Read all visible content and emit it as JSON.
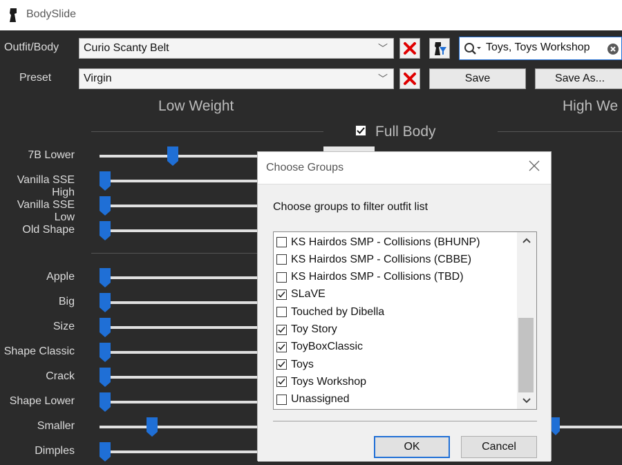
{
  "window": {
    "title": "BodySlide"
  },
  "outfit": {
    "label": "Outfit/Body",
    "value": "Curio Scanty Belt"
  },
  "preset": {
    "label": "Preset",
    "value": "Virgin",
    "save_label": "Save",
    "save_as_label": "Save As..."
  },
  "filter": {
    "value": "Toys, Toys Workshop"
  },
  "sections": {
    "low_weight": "Low Weight",
    "high_weight": "High We",
    "full_body": "Full Body"
  },
  "sliders": [
    {
      "label": "7B Lower",
      "value": 0.23
    },
    {
      "label": "Vanilla SSE High",
      "value": 0.0
    },
    {
      "label": "Vanilla SSE Low",
      "value": 0.0
    },
    {
      "label": "Old Shape",
      "value": 0.0
    },
    {
      "label": "Apple",
      "value": 0.0
    },
    {
      "label": "Big",
      "value": 0.0
    },
    {
      "label": "Size",
      "value": 0.0
    },
    {
      "label": "Shape Classic",
      "value": 0.0
    },
    {
      "label": "Crack",
      "value": 0.0
    },
    {
      "label": "Shape Lower",
      "value": 0.0
    },
    {
      "label": "Smaller",
      "value": 0.16
    },
    {
      "label": "Dimples",
      "value": 0.0
    }
  ],
  "dialog": {
    "title": "Choose Groups",
    "prompt": "Choose groups to filter outfit list",
    "groups": [
      {
        "label": "KS Hairdos SMP - Collisions (BHUNP)",
        "checked": false
      },
      {
        "label": "KS Hairdos SMP - Collisions (CBBE)",
        "checked": false
      },
      {
        "label": "KS Hairdos SMP - Collisions (TBD)",
        "checked": false
      },
      {
        "label": "SLaVE",
        "checked": true
      },
      {
        "label": "Touched by Dibella",
        "checked": false
      },
      {
        "label": "Toy Story",
        "checked": true
      },
      {
        "label": "ToyBoxClassic",
        "checked": true
      },
      {
        "label": "Toys",
        "checked": true
      },
      {
        "label": "Toys Workshop",
        "checked": true
      },
      {
        "label": "Unassigned",
        "checked": false
      }
    ],
    "ok_label": "OK",
    "cancel_label": "Cancel"
  },
  "colors": {
    "accent_blue": "#1f6fd6",
    "delete_red": "#e00000"
  }
}
